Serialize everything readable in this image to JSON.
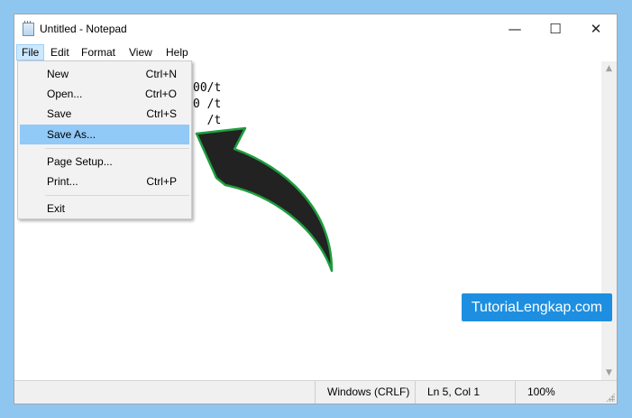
{
  "window": {
    "title": "Untitled - Notepad"
  },
  "controls": {
    "minimize": "—",
    "maximize": "☐",
    "close": "✕"
  },
  "menubar": {
    "items": [
      "File",
      "Edit",
      "Format",
      "View",
      "Help"
    ]
  },
  "editor": {
    "lines": [
      "00/t",
      "0 /t",
      "  /t"
    ]
  },
  "file_menu": {
    "new": {
      "label": "New",
      "shortcut": "Ctrl+N"
    },
    "open": {
      "label": "Open...",
      "shortcut": "Ctrl+O"
    },
    "save": {
      "label": "Save",
      "shortcut": "Ctrl+S"
    },
    "save_as": {
      "label": "Save As..."
    },
    "page_setup": {
      "label": "Page Setup..."
    },
    "print": {
      "label": "Print...",
      "shortcut": "Ctrl+P"
    },
    "exit": {
      "label": "Exit"
    }
  },
  "statusbar": {
    "line_ending": "Windows (CRLF)",
    "position": "Ln 5, Col 1",
    "zoom": "100%"
  },
  "scrollbar": {
    "up": "▲",
    "down": "▼"
  },
  "watermark": {
    "text": "TutoriaLengkap.com"
  },
  "colors": {
    "background": "#8fc6ef",
    "highlight": "#91c9f7",
    "badge": "#1e8fe0",
    "arrow_fill": "#222222",
    "arrow_stroke": "#1e9e3e"
  },
  "icons": {
    "app": "notepad-icon",
    "annotation": "curved-arrow"
  }
}
